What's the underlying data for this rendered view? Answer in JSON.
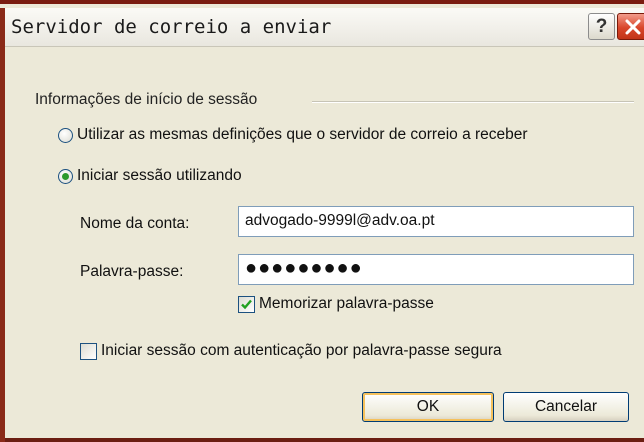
{
  "window": {
    "title": "Servidor de correio a enviar"
  },
  "titlebar": {
    "help_label": "?"
  },
  "login_group": {
    "title": "Informações de início de sessão",
    "radio_same_settings": "Utilizar as mesmas definições que o servidor de correio a receber",
    "radio_login_using": "Iniciar sessão utilizando",
    "selected_radio": "radio_login_using",
    "account_label": "Nome da conta:",
    "account_value": "advogado-9999l@adv.oa.pt",
    "password_label": "Palavra-passe:",
    "password_value": "●●●●●●●●●",
    "remember_password_label": "Memorizar palavra-passe",
    "remember_password_checked": true,
    "spa_label": "Iniciar sessão com autenticação por palavra-passe segura",
    "spa_checked": false
  },
  "buttons": {
    "ok": "OK",
    "cancel": "Cancelar"
  },
  "colors": {
    "title_close_red": "#d9462b",
    "radio_dot_green": "#2c9a2c",
    "checkmark_green": "#21a121",
    "focus_orange": "#f5c15c"
  }
}
